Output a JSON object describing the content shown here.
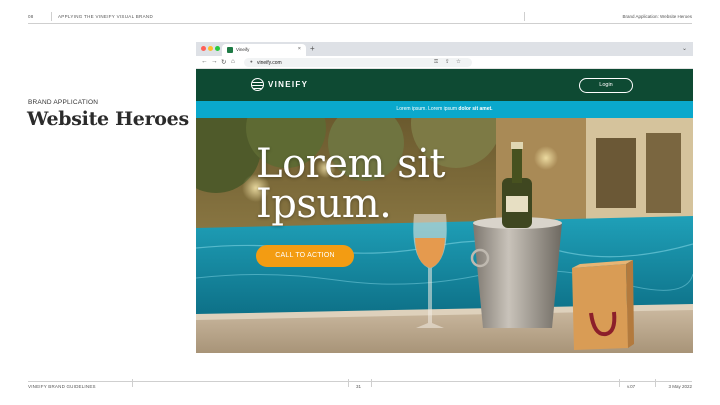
{
  "header": {
    "section_number": "08",
    "section_title": "APPLYING THE VINEIFY VISUAL BRAND",
    "right_label": "Brand Application: Website Heroes"
  },
  "page": {
    "eyebrow": "BRAND APPLICATION",
    "title": "Website Heroes"
  },
  "browser": {
    "tab_label": "Vineify",
    "tab_close": "×",
    "new_tab": "+",
    "tab_menu": "⌄",
    "url": "vineify.com",
    "nav_icons": [
      "back-arrow-icon",
      "forward-arrow-icon",
      "reload-icon",
      "home-icon"
    ]
  },
  "site": {
    "logo_text": "VINEIFY",
    "login_label": "Login",
    "promo_text_regular": "Lorem ipsum. Lorem ipsum ",
    "promo_text_bold": "dolor sit amet.",
    "hero_line1": "Lorem sit",
    "hero_line2": "Ipsum.",
    "cta_label": "CALL TO ACTION"
  },
  "footer": {
    "left": "VINEIFY BRAND GUIDELINES",
    "page_number": "31",
    "version": "v.07",
    "date": "3 May 2022"
  },
  "colors": {
    "nav_bg": "#0e4a33",
    "promo_bg": "#0aa8cc",
    "cta_bg": "#f39c12"
  }
}
